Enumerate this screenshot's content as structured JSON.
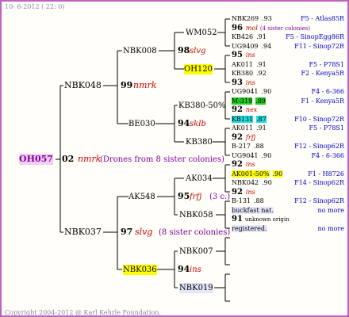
{
  "date": "10-  6-2012 ( 22:  0)",
  "copyright": "Copyright 2004-2012 @ Karl Kehrle Foundation.",
  "root": {
    "id": "OH057",
    "num": "02",
    "breed": "nmrk",
    "note": "(Drones from 8 sister colonies)"
  },
  "gen1": [
    {
      "id": "NBK048",
      "num": "99",
      "breed": "nmrk"
    },
    {
      "id": "NBK037",
      "num": "97",
      "breed": "slvg",
      "note": "(8 sister colonies)"
    }
  ],
  "gen2": [
    {
      "id": "NBK008",
      "num": "98",
      "breed": "slvg"
    },
    {
      "id": "BE030",
      "num": "94",
      "breed": "sklb"
    },
    {
      "id": "AK548",
      "num": "95",
      "breed": "frfj",
      "note": "(3 c.)"
    },
    {
      "id": "NBK036",
      "num": "94",
      "breed": "ins"
    }
  ],
  "gen3": [
    "WM052",
    "OH120",
    "KB380-50%",
    "KB380",
    "AK034",
    "NBK058",
    "NBK007",
    "NBK019"
  ],
  "gen4": [
    {
      "id": "NBK269",
      "val": ".93",
      "loc": "F5 - Atlas85R"
    },
    {
      "num": "96",
      "breed": "mol",
      "note": "(4 sister colonies)"
    },
    {
      "id": "KB426",
      "val": ".91",
      "loc": "F5 - SinopEgg86R"
    },
    {
      "id": "UG9409",
      "val": ".94",
      "loc": "F11 - Sinop72R"
    },
    {
      "num": "95",
      "breed": "ins"
    },
    {
      "id": "AK011",
      "val": ".91",
      "loc": "F5 - P78S1"
    },
    {
      "id": "KB380",
      "val": ".92",
      "loc": "F2 - Kenya5R"
    },
    {
      "num": "93",
      "breed": "ins"
    },
    {
      "id": "UG9041",
      "val": ".90",
      "loc": "F4 - 6-366"
    },
    {
      "id": "M-319",
      "val": ".89",
      "loc": "F1 - Kenya5R"
    },
    {
      "num": "92",
      "breed": "nex"
    },
    {
      "id": "KB131",
      "val": ".87",
      "loc": "F10 - Sinop72R"
    },
    {
      "id": "AK011",
      "val": ".91",
      "loc": "F5 - P78S1"
    },
    {
      "num": "92",
      "breed": "frfj"
    },
    {
      "id": "B-217",
      "val": ".88",
      "loc": "F12 - Sinop62R"
    },
    {
      "id": "UG9041",
      "val": ".90",
      "loc": "F4 - 6-366"
    },
    {
      "num": "92",
      "breed": "ins"
    },
    {
      "id": "AK001-50%",
      "val": ".90",
      "loc": "F1 - H8726"
    },
    {
      "id": "NBK042",
      "val": ".90",
      "loc": "F14 - Sinop62R"
    },
    {
      "num": "92",
      "breed": "ins"
    },
    {
      "id": "B-131",
      "val": ".88",
      "loc": "F12 - Sinop62R"
    },
    {
      "id": "buckfast nat.",
      "loc": "no more"
    },
    {
      "num": "91",
      "note": "unknown origin"
    },
    {
      "id": "registered.",
      "loc": "no more"
    }
  ]
}
